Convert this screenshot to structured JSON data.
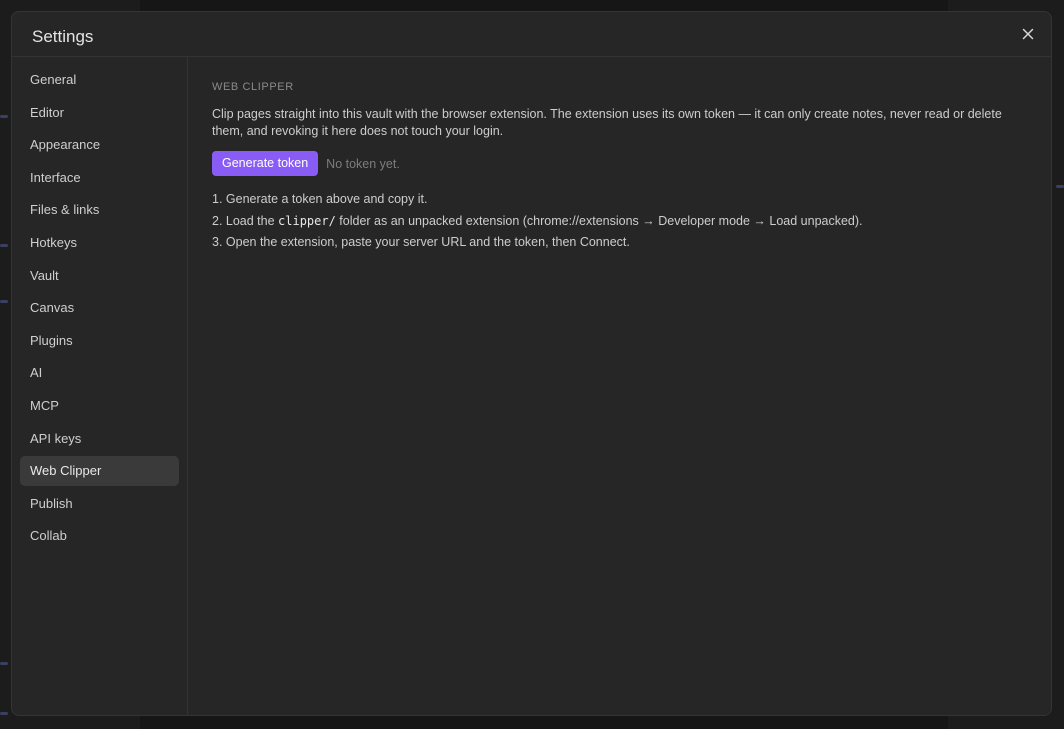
{
  "modal": {
    "title": "Settings",
    "close_icon": "close-icon"
  },
  "sidebar": {
    "items": [
      {
        "label": "General",
        "active": false
      },
      {
        "label": "Editor",
        "active": false
      },
      {
        "label": "Appearance",
        "active": false
      },
      {
        "label": "Interface",
        "active": false
      },
      {
        "label": "Files & links",
        "active": false
      },
      {
        "label": "Hotkeys",
        "active": false
      },
      {
        "label": "Vault",
        "active": false
      },
      {
        "label": "Canvas",
        "active": false
      },
      {
        "label": "Plugins",
        "active": false
      },
      {
        "label": "AI",
        "active": false
      },
      {
        "label": "MCP",
        "active": false
      },
      {
        "label": "API keys",
        "active": false
      },
      {
        "label": "Web Clipper",
        "active": true
      },
      {
        "label": "Publish",
        "active": false
      },
      {
        "label": "Collab",
        "active": false
      }
    ]
  },
  "web_clipper": {
    "section_title": "WEB CLIPPER",
    "description": "Clip pages straight into this vault with the browser extension. The extension uses its own token — it can only create notes, never read or delete them, and revoking it here does not touch your login.",
    "generate_button": "Generate token",
    "token_status": "No token yet.",
    "steps": [
      {
        "prefix": "1. Generate a token above and copy it.",
        "code": "",
        "suffix": ""
      },
      {
        "prefix": "2. Load the ",
        "code": "clipper/",
        "suffix": " folder as an unpacked extension (chrome://extensions → Developer mode → Load unpacked)."
      },
      {
        "prefix": "3. Open the extension, paste your server URL and the token, then Connect.",
        "code": "",
        "suffix": ""
      }
    ]
  },
  "colors": {
    "accent": "#8a5cf6",
    "modal_bg": "#262626",
    "active_item_bg": "#3a3a3a"
  }
}
